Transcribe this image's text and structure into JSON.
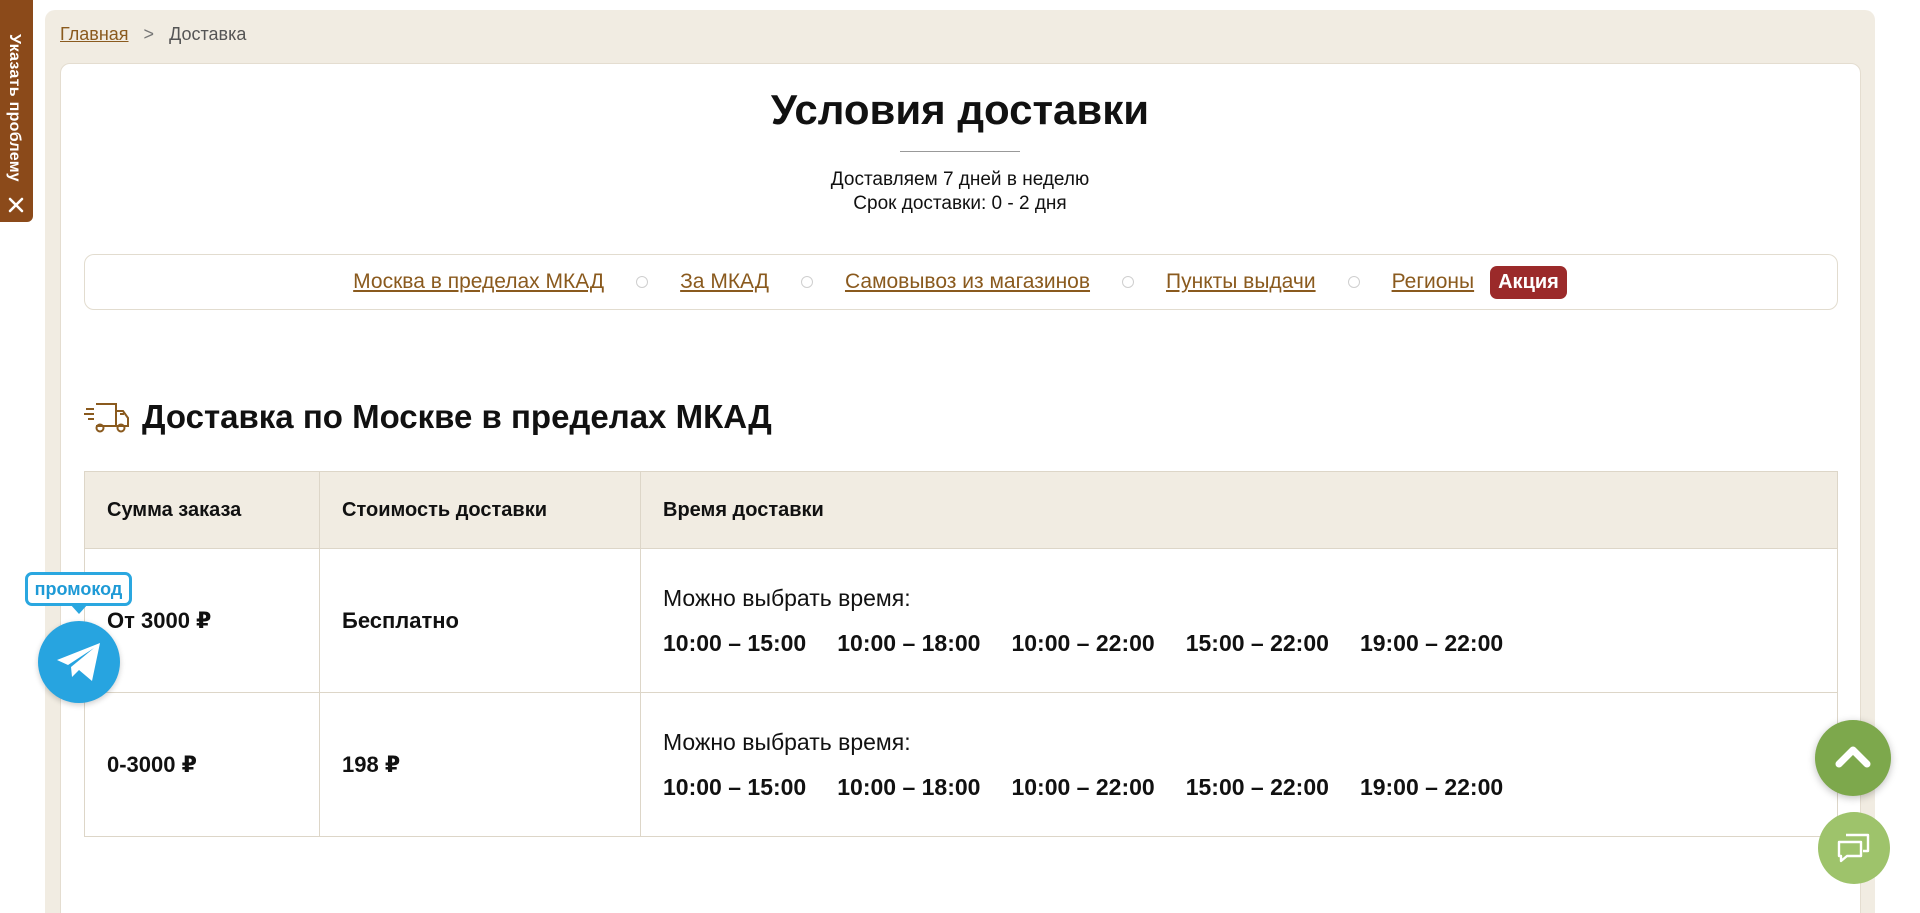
{
  "breadcrumb": {
    "home": "Главная",
    "separator": ">",
    "current": "Доставка"
  },
  "header": {
    "title": "Условия доставки",
    "line1": "Доставляем 7 дней в неделю",
    "line2": "Срок доставки: 0 - 2 дня"
  },
  "tabs": [
    {
      "label": "Москва в пределах МКАД"
    },
    {
      "label": "За МКАД"
    },
    {
      "label": "Самовывоз из магазинов"
    },
    {
      "label": "Пункты выдачи"
    },
    {
      "label": "Регионы"
    }
  ],
  "promo_badge": "Акция",
  "section": {
    "title": "Доставка по Москве в пределах МКАД",
    "icon": "delivery-truck-icon"
  },
  "table": {
    "headers": [
      "Сумма заказа",
      "Стоимость доставки",
      "Время доставки"
    ],
    "rows": [
      {
        "sum": "От 3000 ₽",
        "cost": "Бесплатно",
        "caption": "Можно выбрать время:",
        "slots": [
          "10:00 – 15:00",
          "10:00 – 18:00",
          "10:00 – 22:00",
          "15:00 – 22:00",
          "19:00 – 22:00"
        ]
      },
      {
        "sum": "0-3000 ₽",
        "cost": "198 ₽",
        "caption": "Можно выбрать время:",
        "slots": [
          "10:00 – 15:00",
          "10:00 – 18:00",
          "10:00 – 22:00",
          "15:00 – 22:00",
          "19:00 – 22:00"
        ]
      }
    ]
  },
  "report_tab": {
    "label": "Указать проблему",
    "icon": "close-icon"
  },
  "telegram_widget": {
    "label": "промокод",
    "icon": "telegram-icon"
  },
  "floating": {
    "scroll_top_icon": "chevron-up-icon",
    "chat_icon": "chat-icon"
  },
  "colors": {
    "accent_brown": "#8a5a1e",
    "panel_beige": "#f1ece2",
    "promo_red": "#9b2a2a",
    "telegram_blue": "#27a4e0",
    "green_button": "#7da84c"
  }
}
